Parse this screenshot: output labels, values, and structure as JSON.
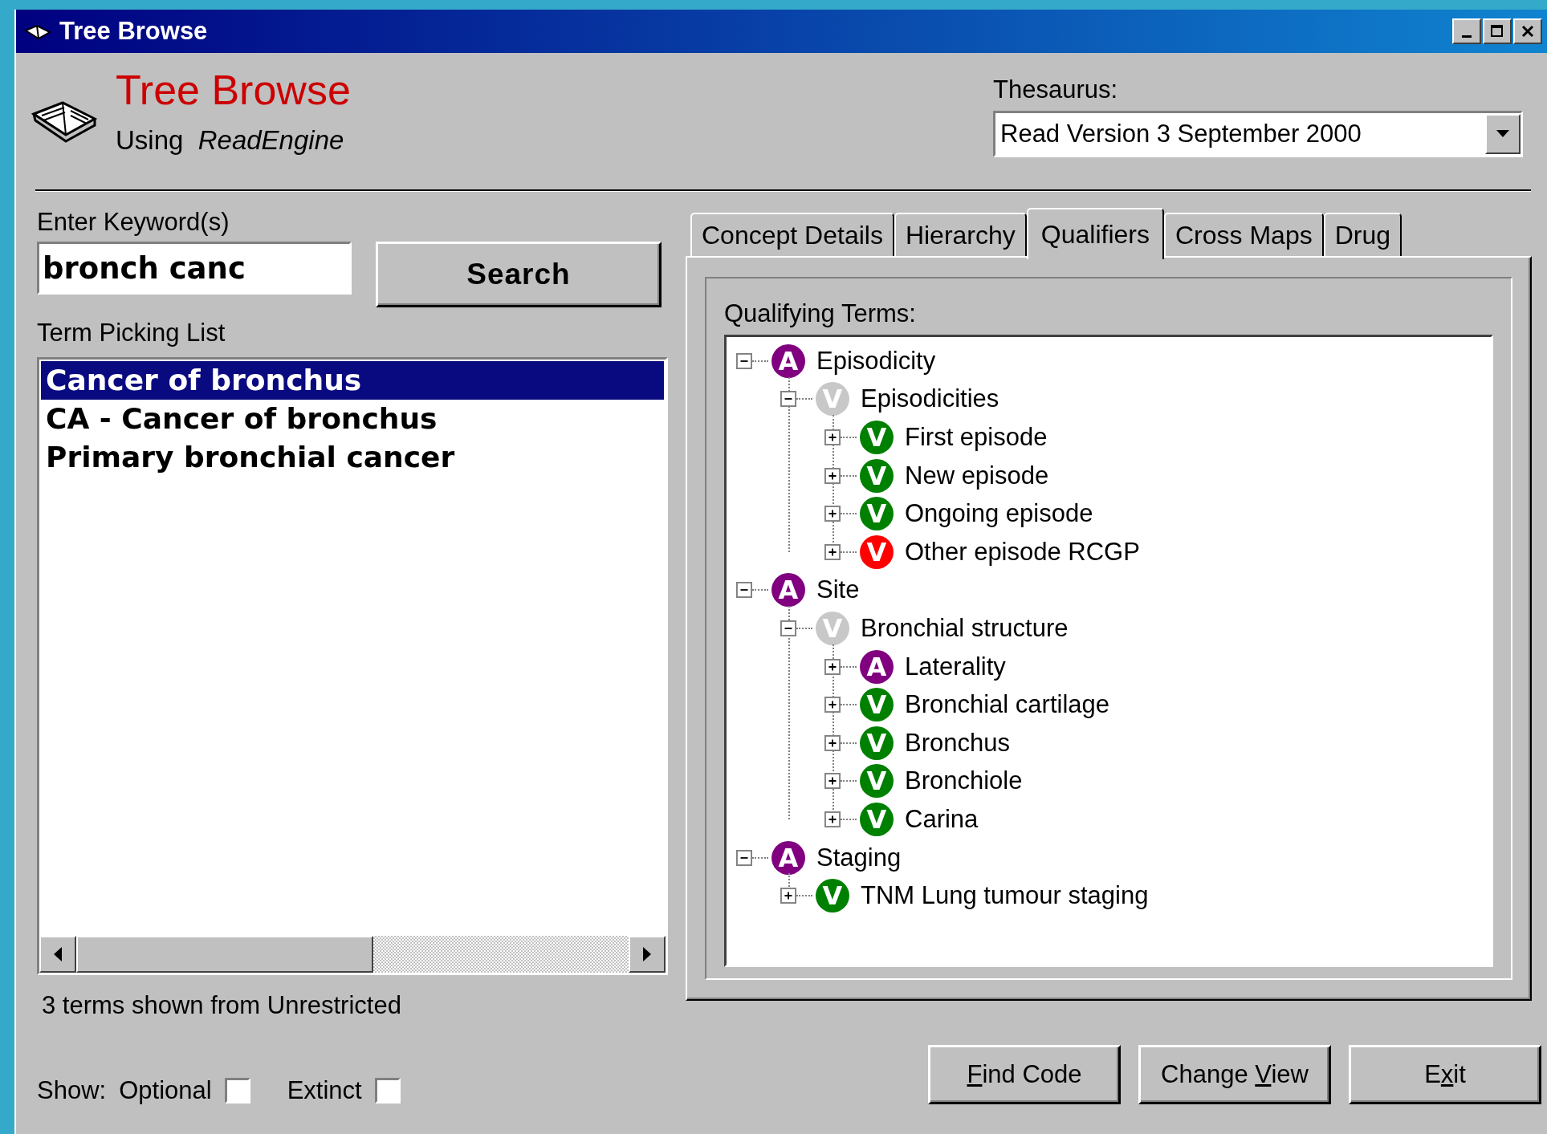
{
  "window": {
    "title": "Tree Browse"
  },
  "header": {
    "title": "Tree Browse",
    "subtitle": "Using  *ReadEngine*"
  },
  "thesaurus": {
    "label": "Thesaurus:",
    "value": "Read Version 3 September 2000"
  },
  "keyword": {
    "label": "Enter Keyword(s)",
    "value": "bronch canc"
  },
  "search_button": "Search",
  "term_list": {
    "label": "Term Picking List",
    "items": [
      {
        "text": "Cancer of bronchus",
        "selected": true
      },
      {
        "text": "CA - Cancer of bronchus",
        "selected": false
      },
      {
        "text": "Primary bronchial cancer",
        "selected": false
      }
    ]
  },
  "status": "3 terms shown from Unrestricted",
  "show": {
    "label": "Show:",
    "options": [
      {
        "label": "Optional",
        "checked": false
      },
      {
        "label": "Extinct",
        "checked": false
      }
    ]
  },
  "tabs": [
    {
      "label": "Concept Details",
      "selected": false
    },
    {
      "label": "Hierarchy",
      "selected": false
    },
    {
      "label": "Qualifiers",
      "selected": true
    },
    {
      "label": "Cross Maps",
      "selected": false
    },
    {
      "label": "Drug",
      "selected": false
    }
  ],
  "qualifying": {
    "label": "Qualifying Terms:",
    "tree": [
      {
        "label": "Episodicity",
        "badge": "A",
        "color": "#800080",
        "expanded": true,
        "children": [
          {
            "label": "Episodicities",
            "badge": "V",
            "color": "#c8c8c8",
            "expanded": true,
            "children": [
              {
                "label": "First episode",
                "badge": "V",
                "color": "#008000",
                "expanded": false
              },
              {
                "label": "New episode",
                "badge": "V",
                "color": "#008000",
                "expanded": false
              },
              {
                "label": "Ongoing episode",
                "badge": "V",
                "color": "#008000",
                "expanded": false
              },
              {
                "label": "Other episode RCGP",
                "badge": "V",
                "color": "#ff0000",
                "expanded": false
              }
            ]
          }
        ]
      },
      {
        "label": "Site",
        "badge": "A",
        "color": "#800080",
        "expanded": true,
        "children": [
          {
            "label": "Bronchial structure",
            "badge": "V",
            "color": "#c8c8c8",
            "expanded": true,
            "children": [
              {
                "label": "Laterality",
                "badge": "A",
                "color": "#800080",
                "expanded": false
              },
              {
                "label": "Bronchial cartilage",
                "badge": "V",
                "color": "#008000",
                "expanded": false
              },
              {
                "label": "Bronchus",
                "badge": "V",
                "color": "#008000",
                "expanded": false
              },
              {
                "label": "Bronchiole",
                "badge": "V",
                "color": "#008000",
                "expanded": false
              },
              {
                "label": "Carina",
                "badge": "V",
                "color": "#008000",
                "expanded": false
              }
            ]
          }
        ]
      },
      {
        "label": "Staging",
        "badge": "A",
        "color": "#800080",
        "expanded": true,
        "children": [
          {
            "label": "TNM Lung tumour staging",
            "badge": "V",
            "color": "#008000",
            "expanded": false
          }
        ]
      }
    ]
  },
  "buttons": [
    {
      "access_key": "F",
      "after": "ind Code"
    },
    {
      "before": "Change ",
      "access_key": "V",
      "after": "iew"
    },
    {
      "before": "E",
      "access_key": "x",
      "after": "it"
    }
  ]
}
